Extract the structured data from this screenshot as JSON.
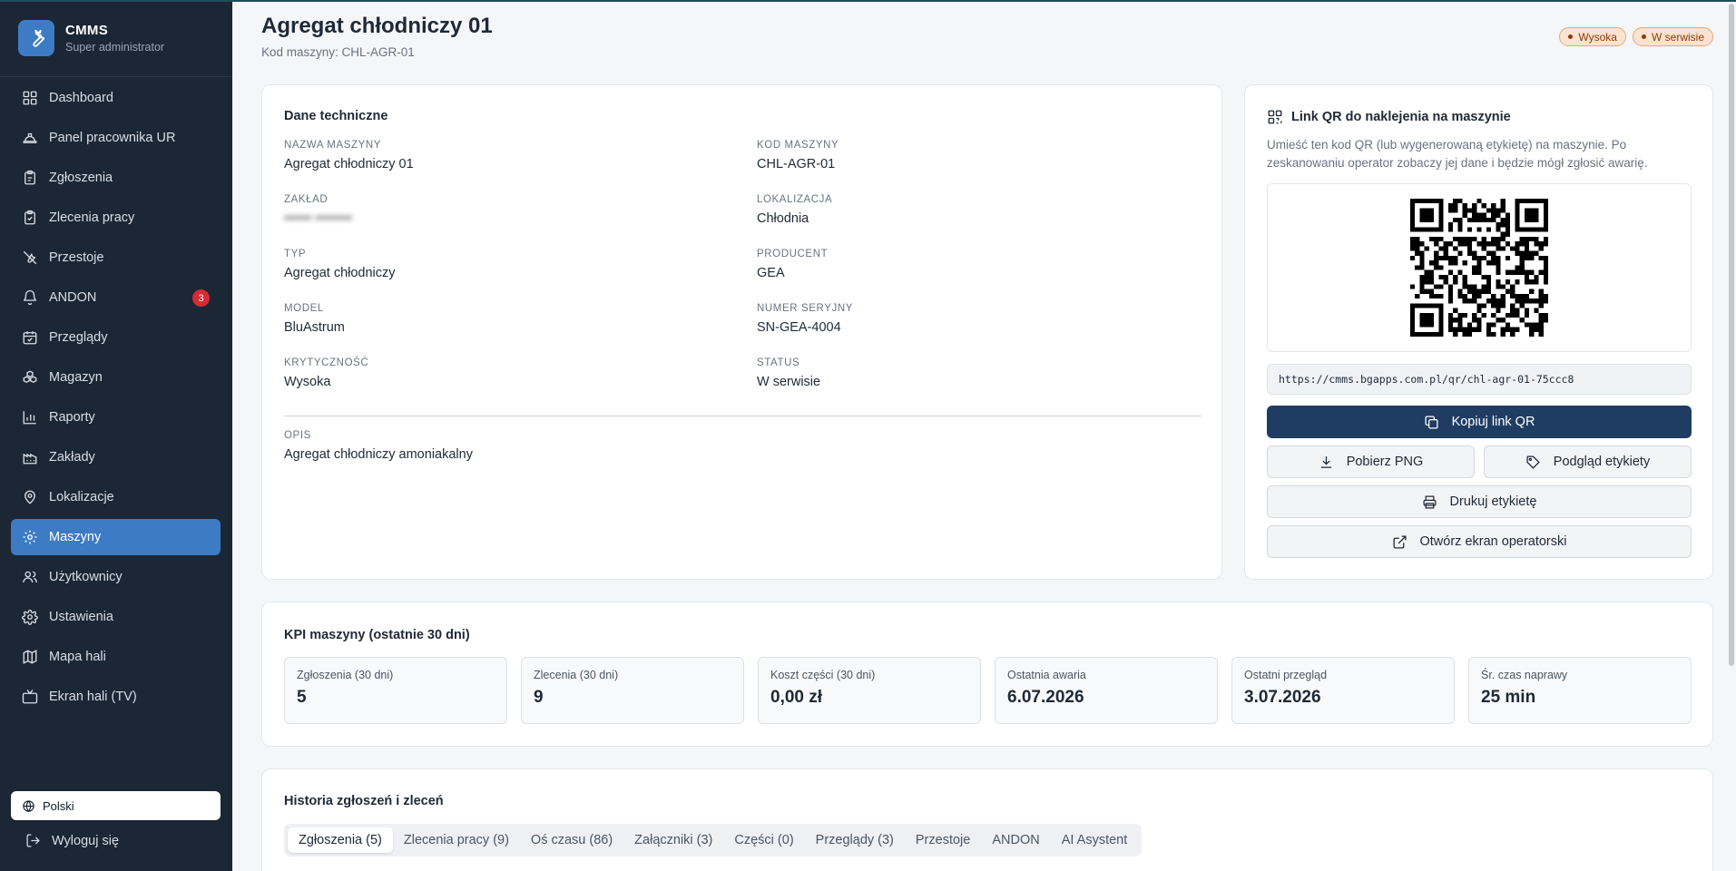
{
  "brand": {
    "title": "CMMS",
    "subtitle": "Super administrator"
  },
  "sidebar": {
    "items": [
      {
        "label": "Dashboard",
        "icon": "dashboard-icon"
      },
      {
        "label": "Panel pracownika UR",
        "icon": "helmet-icon"
      },
      {
        "label": "Zgłoszenia",
        "icon": "clipboard-icon"
      },
      {
        "label": "Zlecenia pracy",
        "icon": "clipboard-check-icon"
      },
      {
        "label": "Przestoje",
        "icon": "wrench-off-icon"
      },
      {
        "label": "ANDON",
        "icon": "bell-icon",
        "badge": "3"
      },
      {
        "label": "Przeglądy",
        "icon": "calendar-check-icon"
      },
      {
        "label": "Magazyn",
        "icon": "boxes-icon"
      },
      {
        "label": "Raporty",
        "icon": "bar-chart-icon"
      },
      {
        "label": "Zakłady",
        "icon": "factory-icon"
      },
      {
        "label": "Lokalizacje",
        "icon": "map-pin-icon"
      },
      {
        "label": "Maszyny",
        "icon": "cog-icon",
        "active": true
      },
      {
        "label": "Użytkownicy",
        "icon": "users-icon"
      },
      {
        "label": "Ustawienia",
        "icon": "settings-icon"
      },
      {
        "label": "Mapa hali",
        "icon": "map-icon"
      },
      {
        "label": "Ekran hali (TV)",
        "icon": "tv-icon"
      }
    ],
    "language": "Polski",
    "logout": "Wyloguj się"
  },
  "header": {
    "title": "Agregat chłodniczy 01",
    "subtitle": "Kod maszyny: CHL-AGR-01",
    "badges": [
      "Wysoka",
      "W serwisie"
    ]
  },
  "tech": {
    "title": "Dane techniczne",
    "fields": [
      {
        "label": "Nazwa maszyny",
        "value": "Agregat chłodniczy 01"
      },
      {
        "label": "Kod maszyny",
        "value": "CHL-AGR-01"
      },
      {
        "label": "Zakład",
        "value": "•••••• ••••••••",
        "redacted": true
      },
      {
        "label": "Lokalizacja",
        "value": "Chłodnia"
      },
      {
        "label": "Typ",
        "value": "Agregat chłodniczy"
      },
      {
        "label": "Producent",
        "value": "GEA"
      },
      {
        "label": "Model",
        "value": "BluAstrum"
      },
      {
        "label": "Numer seryjny",
        "value": "SN-GEA-4004"
      },
      {
        "label": "Krytyczność",
        "value": "Wysoka"
      },
      {
        "label": "Status",
        "value": "W serwisie"
      }
    ],
    "description": {
      "label": "Opis",
      "value": "Agregat chłodniczy amoniakalny"
    }
  },
  "qr": {
    "title": "Link QR do naklejenia na maszynie",
    "description": "Umieść ten kod QR (lub wygenerowaną etykietę) na maszynie. Po zeskanowaniu operator zobaczy jej dane i będzie mógł zgłosić awarię.",
    "url": "https://cmms.bgapps.com.pl/qr/chl-agr-01-75ccc8",
    "copy_label": "Kopiuj link QR",
    "png_label": "Pobierz PNG",
    "preview_label": "Podgląd etykiety",
    "print_label": "Drukuj etykietę",
    "operator_label": "Otwórz ekran operatorski"
  },
  "kpi": {
    "title": "KPI maszyny (ostatnie 30 dni)",
    "tiles": [
      {
        "label": "Zgłoszenia (30 dni)",
        "value": "5"
      },
      {
        "label": "Zlecenia (30 dni)",
        "value": "9"
      },
      {
        "label": "Koszt części (30 dni)",
        "value": "0,00 zł"
      },
      {
        "label": "Ostatnia awaria",
        "value": "6.07.2026"
      },
      {
        "label": "Ostatni przegląd",
        "value": "3.07.2026"
      },
      {
        "label": "Śr. czas naprawy",
        "value": "25 min"
      }
    ]
  },
  "history": {
    "title": "Historia zgłoszeń i zleceń",
    "tabs": [
      {
        "label": "Zgłoszenia (5)",
        "active": true
      },
      {
        "label": "Zlecenia pracy (9)"
      },
      {
        "label": "Oś czasu (86)"
      },
      {
        "label": "Załączniki (3)"
      },
      {
        "label": "Części (0)"
      },
      {
        "label": "Przeglądy (3)"
      },
      {
        "label": "Przestoje"
      },
      {
        "label": "ANDON"
      },
      {
        "label": "AI Asystent"
      }
    ]
  },
  "colors": {
    "sidebar": "#1c2735",
    "accent": "#3d7bc4",
    "primary_button": "#1f3d63",
    "badge_bg": "#fbe3cf",
    "andon_badge": "#d62b35"
  }
}
